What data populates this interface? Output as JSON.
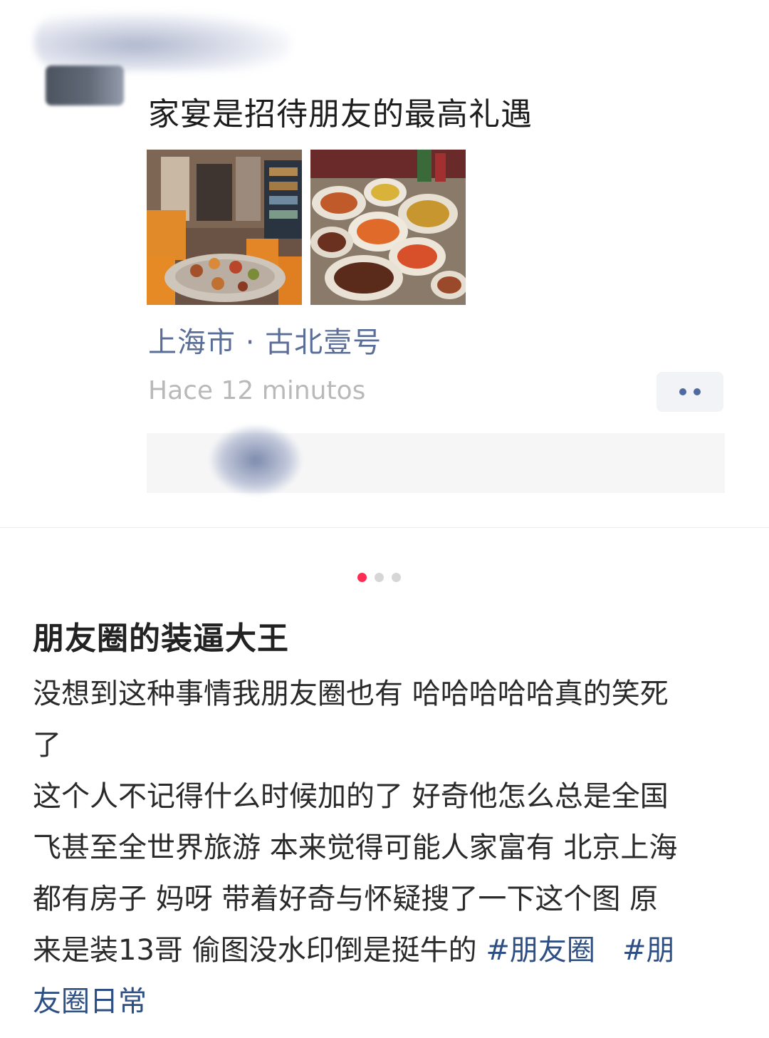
{
  "moment": {
    "text": "家宴是招待朋友的最高礼遇",
    "location": "上海市 · 古北壹号",
    "timestamp": "Hace 12 minutos",
    "images": [
      {
        "icon": "restaurant-interior-photo"
      },
      {
        "icon": "banquet-dishes-photo"
      }
    ],
    "more_icon": "ellipsis-icon"
  },
  "pager": {
    "total": 3,
    "active": 1,
    "active_color": "#fe2c55"
  },
  "article": {
    "title": "朋友圈的装逼大王",
    "lines": [
      "没想到这种事情我朋友圈也有 哈哈哈哈哈真的笑死",
      "了",
      "这个人不记得什么时候加的了  好奇他怎么总是全国",
      "飞甚至全世界旅游 本来觉得可能人家富有 北京上海",
      "都有房子 妈呀 带着好奇与怀疑搜了一下这个图  原"
    ],
    "line6_text": "来是装13哥  偷图没水印倒是挺牛的 ",
    "hashtag_1": "#朋友圈",
    "hashtag_2_part1": "#朋",
    "hashtag_2_part2": "友圈日常",
    "hashtag_color": "#2e4f84"
  }
}
